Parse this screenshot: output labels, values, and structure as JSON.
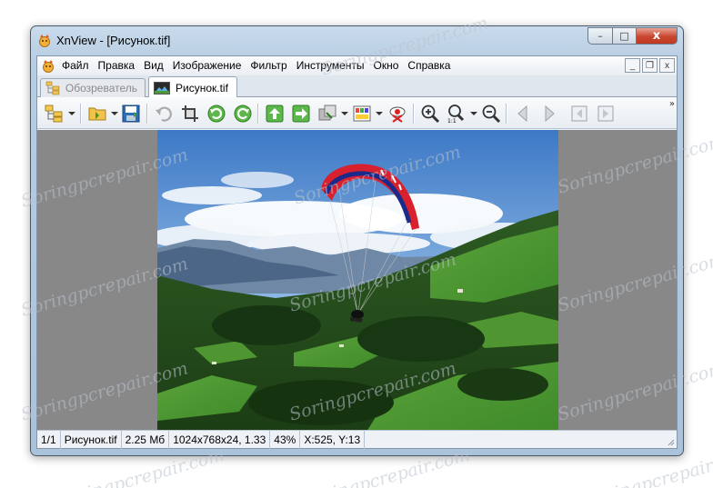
{
  "window": {
    "title": "XnView - [Рисунок.tif]",
    "caption_buttons": {
      "minimize": "–",
      "maximize": "□",
      "close": "x"
    }
  },
  "menu": {
    "items": [
      "Файл",
      "Правка",
      "Вид",
      "Изображение",
      "Фильтр",
      "Инструменты",
      "Окно",
      "Справка"
    ],
    "mdi_buttons": {
      "minimize": "_",
      "restore": "❐",
      "close": "x"
    }
  },
  "tabs": [
    {
      "label": "Обозреватель",
      "active": false,
      "icon": "folder-tree-icon"
    },
    {
      "label": "Рисунок.tif",
      "active": true,
      "icon": "image-icon"
    }
  ],
  "toolbar": {
    "buttons": [
      "browser-tree-icon",
      "open-folder-icon",
      "save-icon",
      "undo-icon",
      "crop-icon",
      "rotate-left-icon",
      "rotate-right-icon",
      "set-wallpaper-icon",
      "export-icon",
      "convert-icon",
      "palette-icon",
      "red-eye-icon",
      "zoom-in-icon",
      "zoom-actual-icon",
      "zoom-out-icon",
      "prev-image-icon",
      "next-image-icon",
      "first-image-icon",
      "last-image-icon"
    ],
    "overflow": "»"
  },
  "status": {
    "index": "1/1",
    "filename": "Рисунок.tif",
    "filesize": "2.25 Мб",
    "dimensions": "1024x768x24, 1.33",
    "zoom": "43%",
    "coords": "X:525, Y:13"
  },
  "watermark": "Soringpcrepair.com",
  "colors": {
    "viewer_bg": "#888888",
    "close_button": "#c8452d",
    "accent": "#3c7fb1"
  }
}
